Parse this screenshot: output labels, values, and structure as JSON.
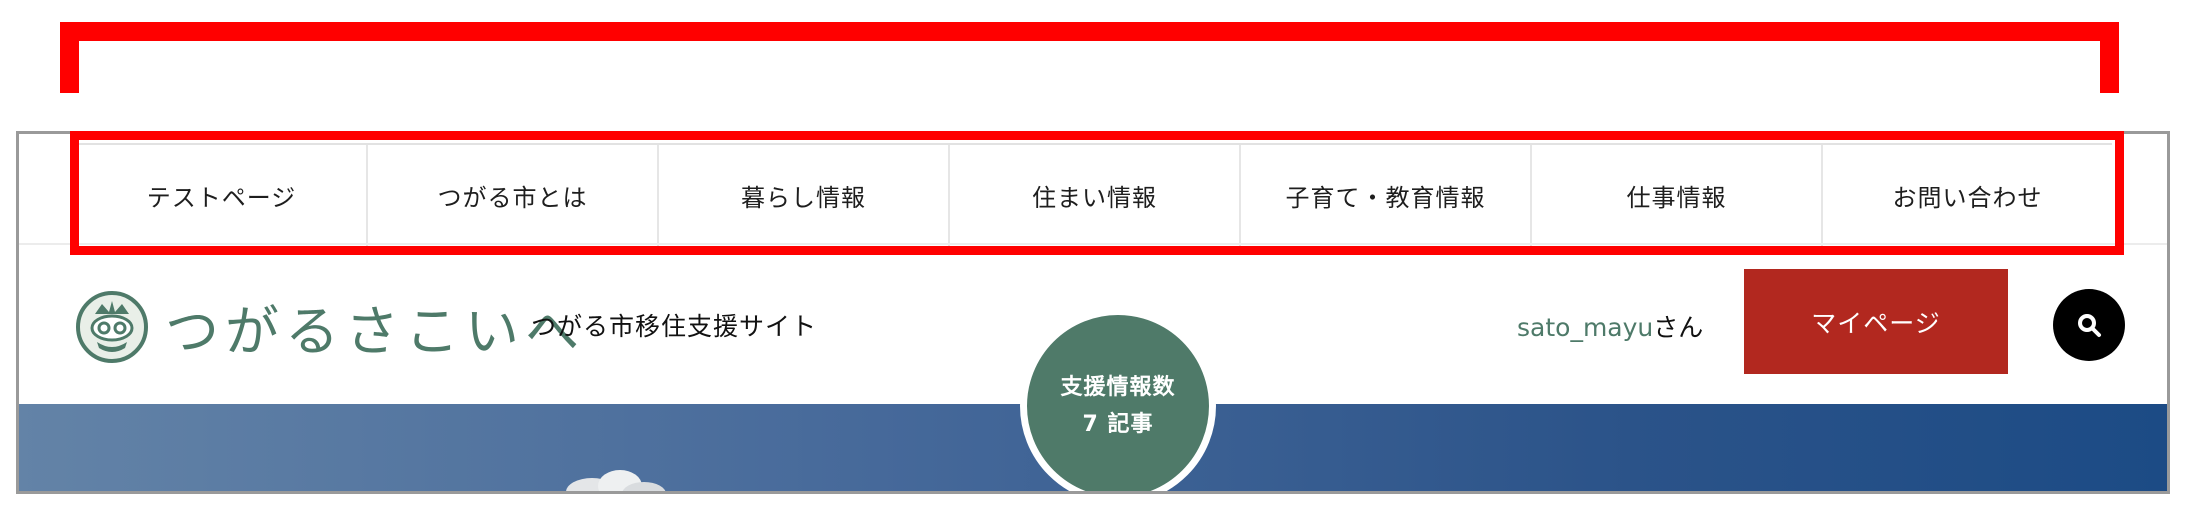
{
  "nav": {
    "items": [
      {
        "label": "テストページ"
      },
      {
        "label": "つがる市とは"
      },
      {
        "label": "暮らし情報"
      },
      {
        "label": "住まい情報"
      },
      {
        "label": "子育て・教育情報"
      },
      {
        "label": "仕事情報"
      },
      {
        "label": "お問い合わせ"
      }
    ]
  },
  "header": {
    "logo_text": "つがるさこいへ",
    "site_name": "つがる市移住支援サイト",
    "user_name": "sato_mayu",
    "user_suffix": "さん",
    "mypage_label": "マイページ",
    "search_icon": "search-icon"
  },
  "badge": {
    "line1": "支援情報数",
    "line2": "7 記事"
  },
  "colors": {
    "brand_green": "#4e7a69",
    "mypage_red": "#b2281f",
    "annotation_red": "#ff0000",
    "hero_blue": "#2b5389"
  }
}
